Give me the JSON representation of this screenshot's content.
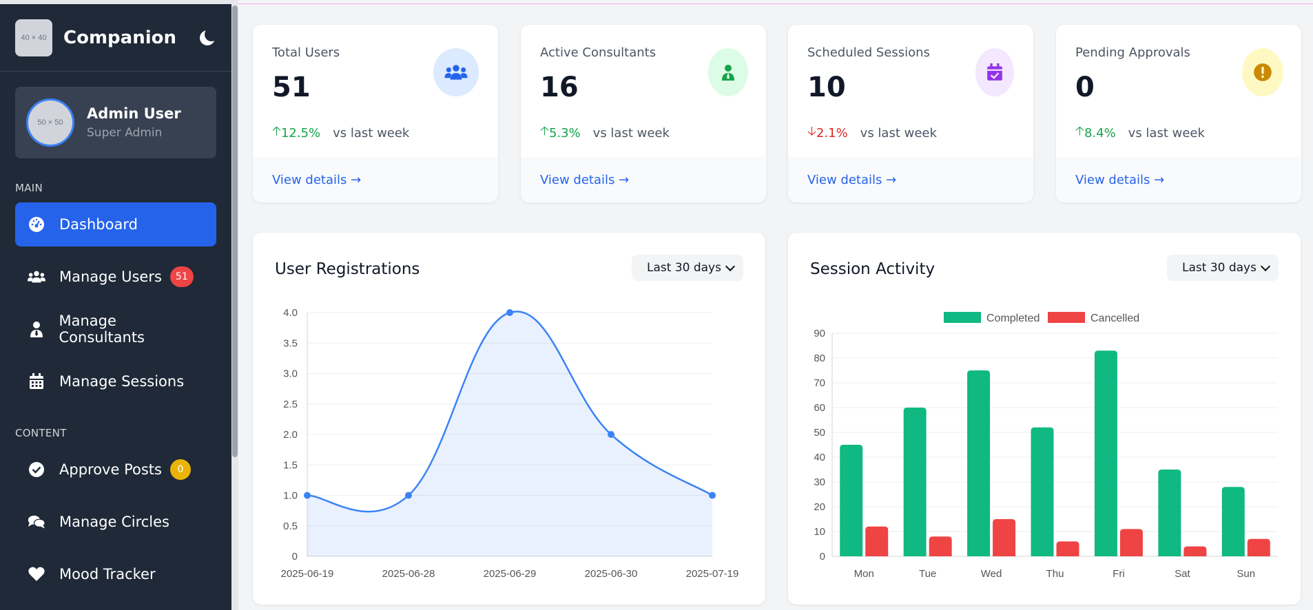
{
  "sidebar": {
    "logo_placeholder": "40 × 40",
    "brand": "Companion",
    "profile": {
      "avatar_placeholder": "50 × 50",
      "name": "Admin User",
      "role": "Super Admin"
    },
    "sections": [
      {
        "label": "MAIN",
        "items": [
          {
            "label": "Dashboard",
            "icon": "dashboard-icon",
            "active": true
          },
          {
            "label": "Manage Users",
            "icon": "users-icon",
            "badge": "51"
          },
          {
            "label": "Manage Consultants",
            "icon": "consultant-icon"
          },
          {
            "label": "Manage Sessions",
            "icon": "calendar-icon"
          }
        ]
      },
      {
        "label": "CONTENT",
        "items": [
          {
            "label": "Approve Posts",
            "icon": "check-circle-icon",
            "badge": "0"
          },
          {
            "label": "Manage Circles",
            "icon": "comments-icon"
          },
          {
            "label": "Mood Tracker",
            "icon": "heart-icon"
          }
        ]
      }
    ]
  },
  "stats": [
    {
      "title": "Total Users",
      "value": "51",
      "change": "12.5%",
      "direction": "up",
      "vs": "vs last week",
      "link": "View details →",
      "icon": "users-icon",
      "icon_bg": "#dbeafe",
      "icon_color": "#2563eb"
    },
    {
      "title": "Active Consultants",
      "value": "16",
      "change": "5.3%",
      "direction": "up",
      "vs": "vs last week",
      "link": "View details →",
      "icon": "consultant-icon",
      "icon_bg": "#dcfce7",
      "icon_color": "#16a34a"
    },
    {
      "title": "Scheduled Sessions",
      "value": "10",
      "change": "2.1%",
      "direction": "down",
      "vs": "vs last week",
      "link": "View details →",
      "icon": "calendar-check-icon",
      "icon_bg": "#f3e8ff",
      "icon_color": "#9333ea"
    },
    {
      "title": "Pending Approvals",
      "value": "0",
      "change": "8.4%",
      "direction": "up",
      "vs": "vs last week",
      "link": "View details →",
      "icon": "exclamation-icon",
      "icon_bg": "#fef9c3",
      "icon_color": "#ca8a04"
    }
  ],
  "panels": {
    "registrations": {
      "title": "User Registrations",
      "range": "Last 30 days"
    },
    "sessions": {
      "title": "Session Activity",
      "range": "Last 30 days"
    }
  },
  "chart_data": [
    {
      "type": "line",
      "title": "User Registrations",
      "x": [
        "2025-06-19",
        "2025-06-28",
        "2025-06-29",
        "2025-06-30",
        "2025-07-19"
      ],
      "series": [
        {
          "values": [
            1,
            1,
            4,
            2,
            1
          ],
          "color": "#3b82f6"
        }
      ],
      "ylim": [
        0,
        4
      ],
      "yticks": [
        "0",
        "0.5",
        "1.0",
        "1.5",
        "2.0",
        "2.5",
        "3.0",
        "3.5",
        "4.0"
      ],
      "fill": true,
      "grid": true
    },
    {
      "type": "bar",
      "title": "Session Activity",
      "categories": [
        "Mon",
        "Tue",
        "Wed",
        "Thu",
        "Fri",
        "Sat",
        "Sun"
      ],
      "series": [
        {
          "name": "Completed",
          "values": [
            45,
            60,
            75,
            52,
            83,
            35,
            28
          ],
          "color": "#10b981"
        },
        {
          "name": "Cancelled",
          "values": [
            12,
            8,
            15,
            6,
            11,
            4,
            7
          ],
          "color": "#ef4444"
        }
      ],
      "ylim": [
        0,
        90
      ],
      "yticks": [
        "0",
        "10",
        "20",
        "30",
        "40",
        "50",
        "60",
        "70",
        "80",
        "90"
      ],
      "legend": "top",
      "grid": true
    }
  ]
}
